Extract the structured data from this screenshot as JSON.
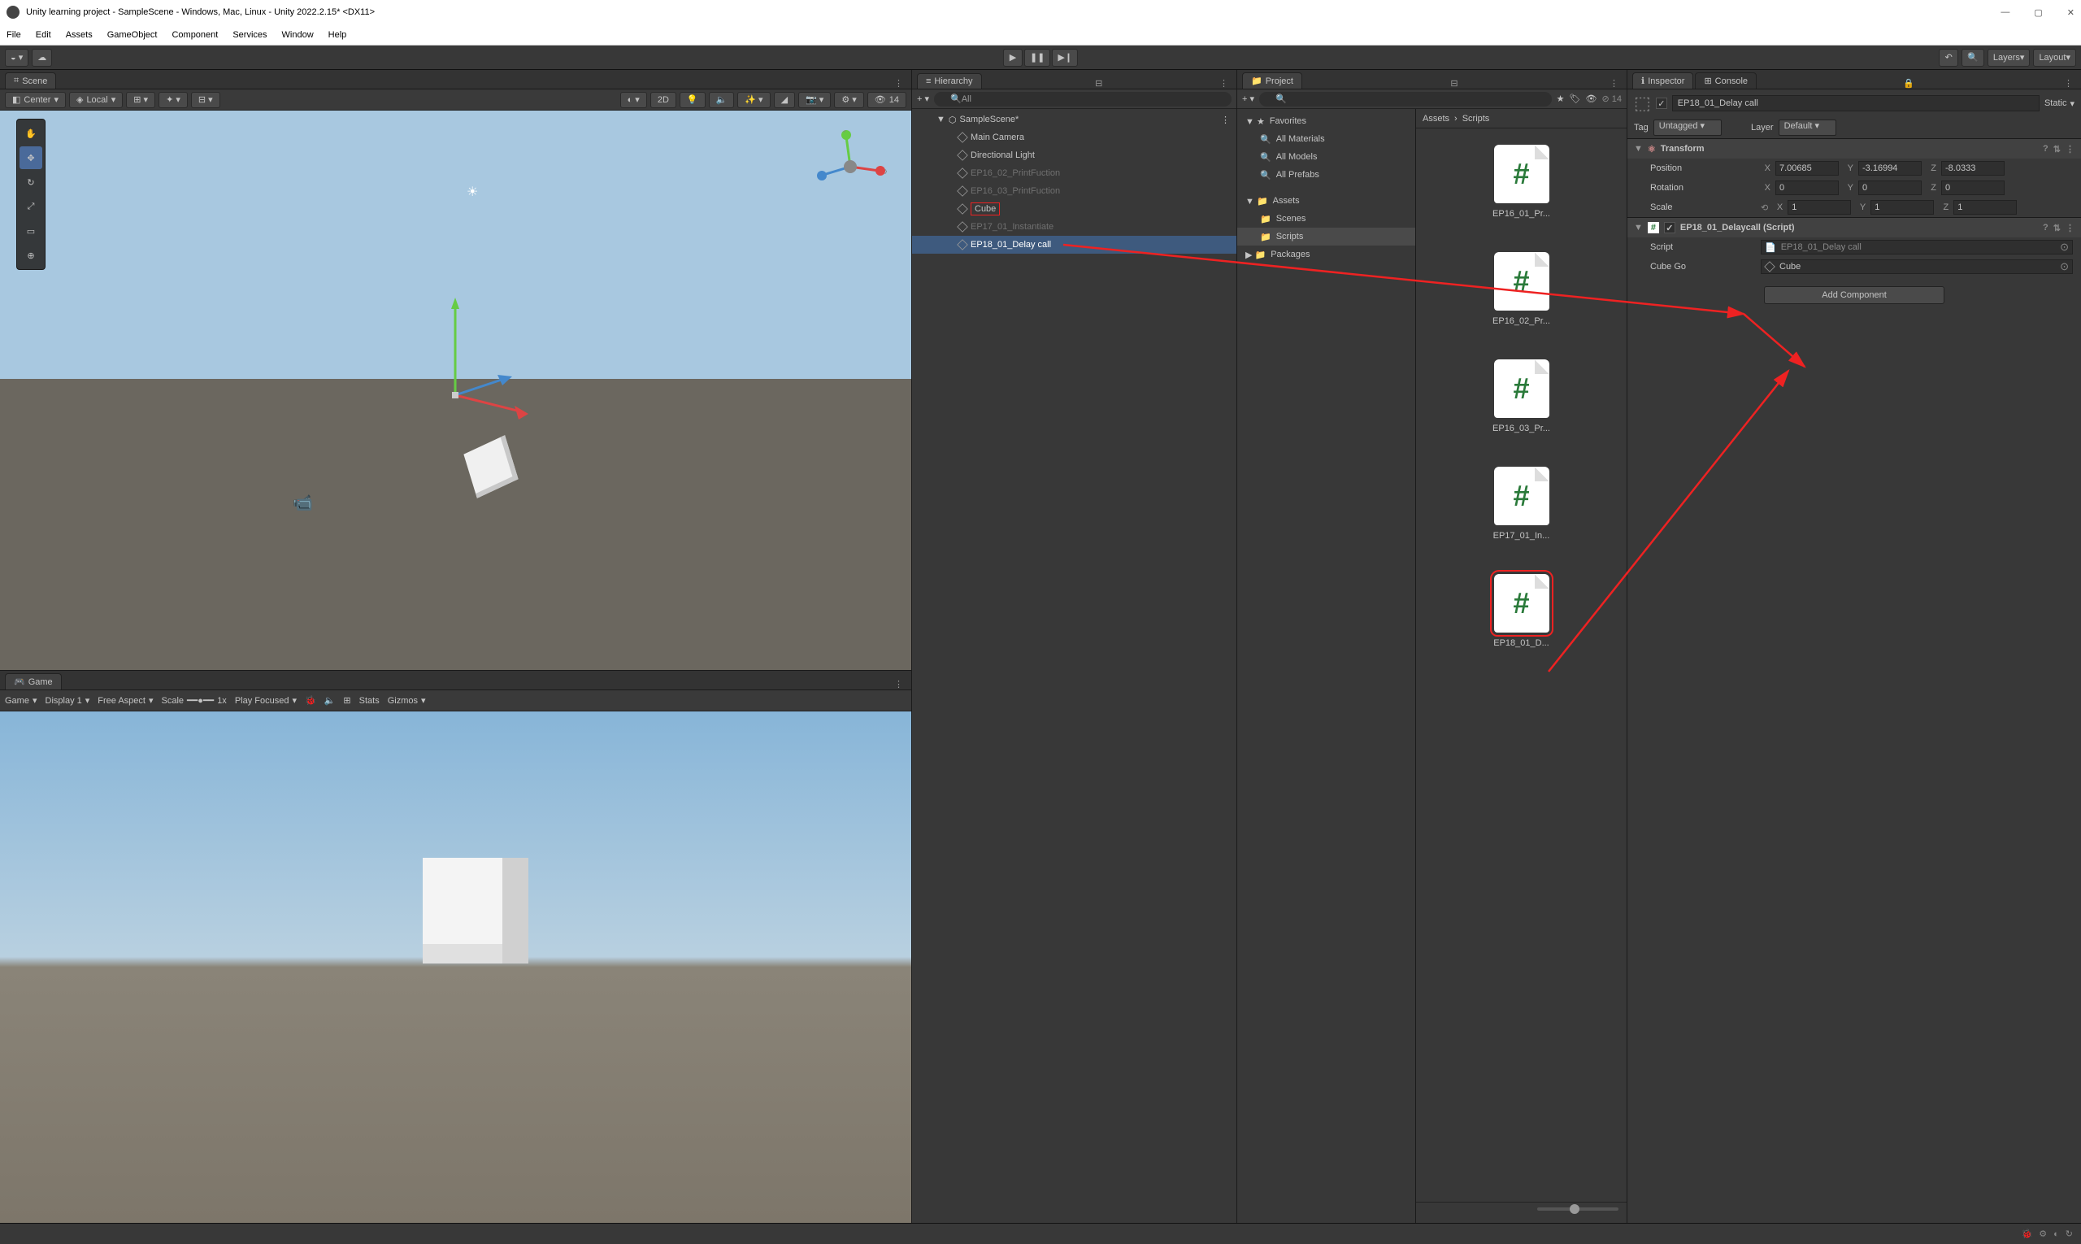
{
  "window": {
    "title": "Unity learning project - SampleScene - Windows, Mac, Linux - Unity 2022.2.15* <DX11>"
  },
  "menu": [
    "File",
    "Edit",
    "Assets",
    "GameObject",
    "Component",
    "Services",
    "Window",
    "Help"
  ],
  "top_toolbar": {
    "layers": "Layers",
    "layout": "Layout"
  },
  "scene": {
    "tab": "Scene",
    "pivot": "Center",
    "local": "Local",
    "count": "14",
    "mode2d": "2D"
  },
  "game": {
    "tab": "Game",
    "display_dd": "Game",
    "display": "Display 1",
    "aspect": "Free Aspect",
    "scale_label": "Scale",
    "scale_val": "1x",
    "play_focused": "Play Focused",
    "stats": "Stats",
    "gizmos": "Gizmos"
  },
  "hierarchy": {
    "tab": "Hierarchy",
    "search_placeholder": "All",
    "scene": "SampleScene*",
    "items": [
      {
        "name": "Main Camera",
        "dim": false
      },
      {
        "name": "Directional Light",
        "dim": false
      },
      {
        "name": "EP16_02_PrintFuction",
        "dim": true
      },
      {
        "name": "EP16_03_PrintFuction",
        "dim": true
      },
      {
        "name": "Cube",
        "dim": false,
        "box": true
      },
      {
        "name": "EP17_01_Instantiate",
        "dim": true
      },
      {
        "name": "EP18_01_Delay call",
        "dim": false,
        "sel": true
      }
    ]
  },
  "project": {
    "tab": "Project",
    "favorites": "Favorites",
    "fav_items": [
      "All Materials",
      "All Models",
      "All Prefabs"
    ],
    "assets": "Assets",
    "folders": [
      {
        "name": "Scenes"
      },
      {
        "name": "Scripts",
        "sel": true,
        "strike": true
      }
    ],
    "packages": "Packages",
    "breadcrumb": [
      "Assets",
      "Scripts"
    ],
    "items": [
      {
        "label": "EP16_01_Pr..."
      },
      {
        "label": "EP16_02_Pr..."
      },
      {
        "label": "EP16_03_Pr..."
      },
      {
        "label": "EP17_01_In..."
      },
      {
        "label": "EP18_01_D...",
        "box": true
      }
    ]
  },
  "inspector": {
    "tab": "Inspector",
    "console_tab": "Console",
    "obj_name": "EP18_01_Delay call",
    "static": "Static",
    "tag_label": "Tag",
    "tag_value": "Untagged",
    "layer_label": "Layer",
    "layer_value": "Default",
    "transform": {
      "title": "Transform",
      "position": "Position",
      "rotation": "Rotation",
      "scale": "Scale",
      "pos": {
        "x": "7.00685",
        "y": "-3.16994",
        "z": "-8.0333"
      },
      "rot": {
        "x": "0",
        "y": "0",
        "z": "0"
      },
      "scl": {
        "x": "1",
        "y": "1",
        "z": "1"
      }
    },
    "script_comp": {
      "title": "EP18_01_Delaycall (Script)",
      "script_label": "Script",
      "script_val": "EP18_01_Delay call",
      "cubego_label": "Cube Go",
      "cubego_val": "Cube"
    },
    "add_component": "Add Component"
  }
}
